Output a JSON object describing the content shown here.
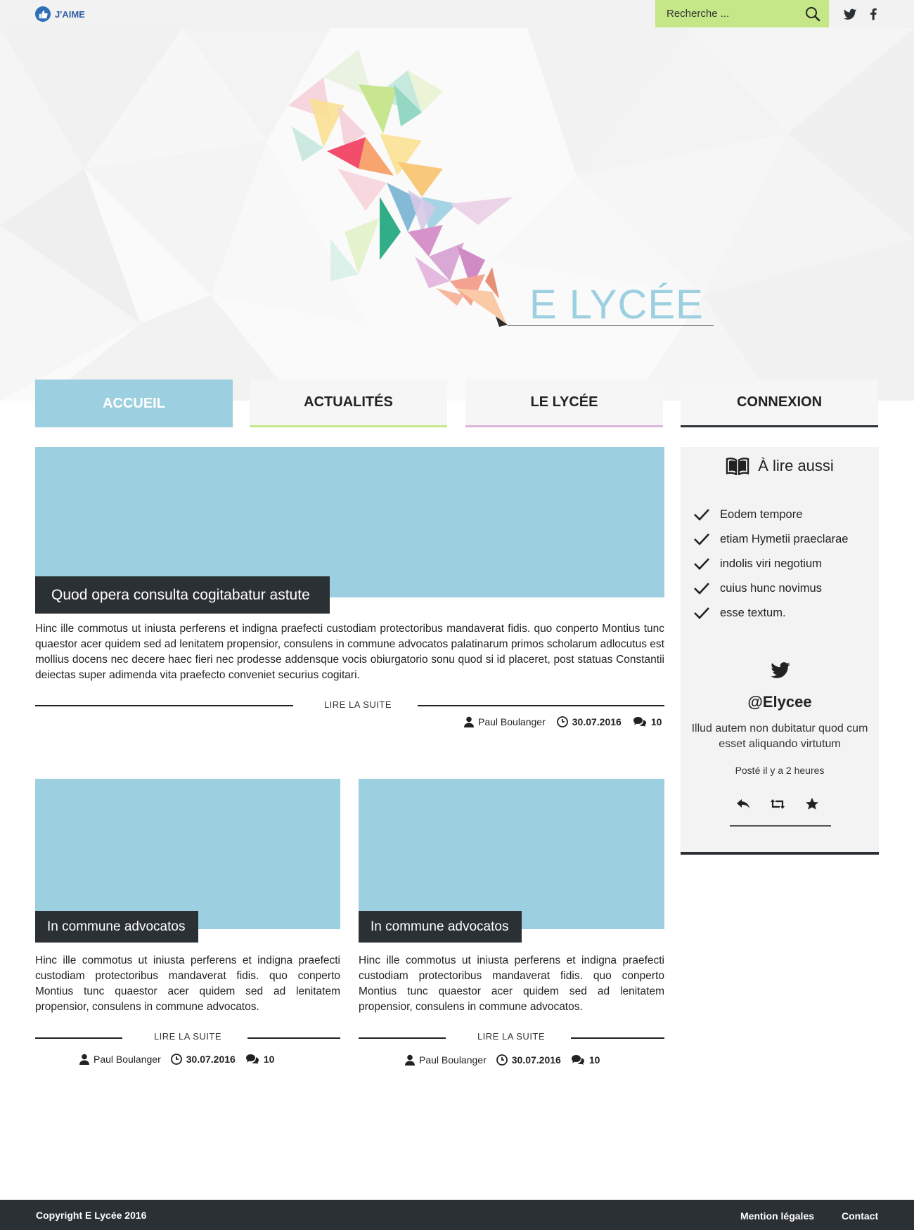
{
  "topbar": {
    "like_label": "J'AIME",
    "search_placeholder": "Recherche ...",
    "icons": [
      "thumbs-up-icon",
      "search-icon",
      "twitter-icon",
      "facebook-icon"
    ]
  },
  "hero": {
    "brand": "E LYCÉE"
  },
  "nav": [
    {
      "label": "ACCUEIL",
      "color": "#9ccfdf"
    },
    {
      "label": "ACTUALITÉS",
      "color": "#c5e787"
    },
    {
      "label": "LE LYCÉE",
      "color": "#dcb6d9"
    },
    {
      "label": "CONNEXION",
      "color": "#2b3035"
    }
  ],
  "featured": {
    "title": "Quod opera consulta cogitabatur astute",
    "excerpt": "Hinc ille commotus ut iniusta perferens et indigna praefecti custodiam protectoribus mandaverat fidis. quo conperto Montius tunc quaestor acer quidem sed ad lenitatem propensior, consulens in commune advocatos palatinarum primos scholarum adlocutus est mollius docens nec decere haec fieri nec prodesse addensque vocis obiurgatorio sonu quod si id placeret, post statuas Constantii deiectas super adimenda vita praefecto conveniet securius cogitari.",
    "read_more": "LIRE LA SUITE",
    "author": "Paul Boulanger",
    "date": "30.07.2016",
    "comments": "10"
  },
  "articles": [
    {
      "title": "In commune advocatos",
      "excerpt": "Hinc ille commotus ut iniusta perferens et indigna praefecti custodiam protectoribus mandaverat fidis. quo conperto Montius tunc quaestor acer quidem sed ad lenitatem propensior, consulens in commune advocatos.",
      "read_more": "LIRE LA SUITE",
      "author": "Paul Boulanger",
      "date": "30.07.2016",
      "comments": "10"
    },
    {
      "title": "In commune advocatos",
      "excerpt": "Hinc ille commotus ut iniusta perferens et indigna praefecti custodiam protectoribus mandaverat fidis. quo conperto Montius tunc quaestor acer quidem sed ad lenitatem propensior, consulens in commune advocatos.",
      "read_more": "LIRE LA SUITE",
      "author": "Paul Boulanger",
      "date": "30.07.2016",
      "comments": "10"
    }
  ],
  "sidebar": {
    "heading": "À lire aussi",
    "items": [
      "Eodem tempore",
      "etiam Hymetii praeclarae",
      "indolis viri negotium",
      "cuius hunc novimus",
      "esse textum."
    ],
    "twitter": {
      "handle": "@Elycee",
      "text": "Illud autem non dubitatur quod cum esset aliquando virtutum",
      "time": "Posté il y a 2 heures"
    }
  },
  "footer": {
    "copyright": "Copyright E Lycée 2016",
    "links": [
      "Mention légales",
      "Contact"
    ]
  },
  "colors": {
    "accent_blue": "#9ccfdf",
    "accent_green": "#c5e787",
    "accent_pink": "#dcb6d9",
    "dark": "#2b3035"
  }
}
